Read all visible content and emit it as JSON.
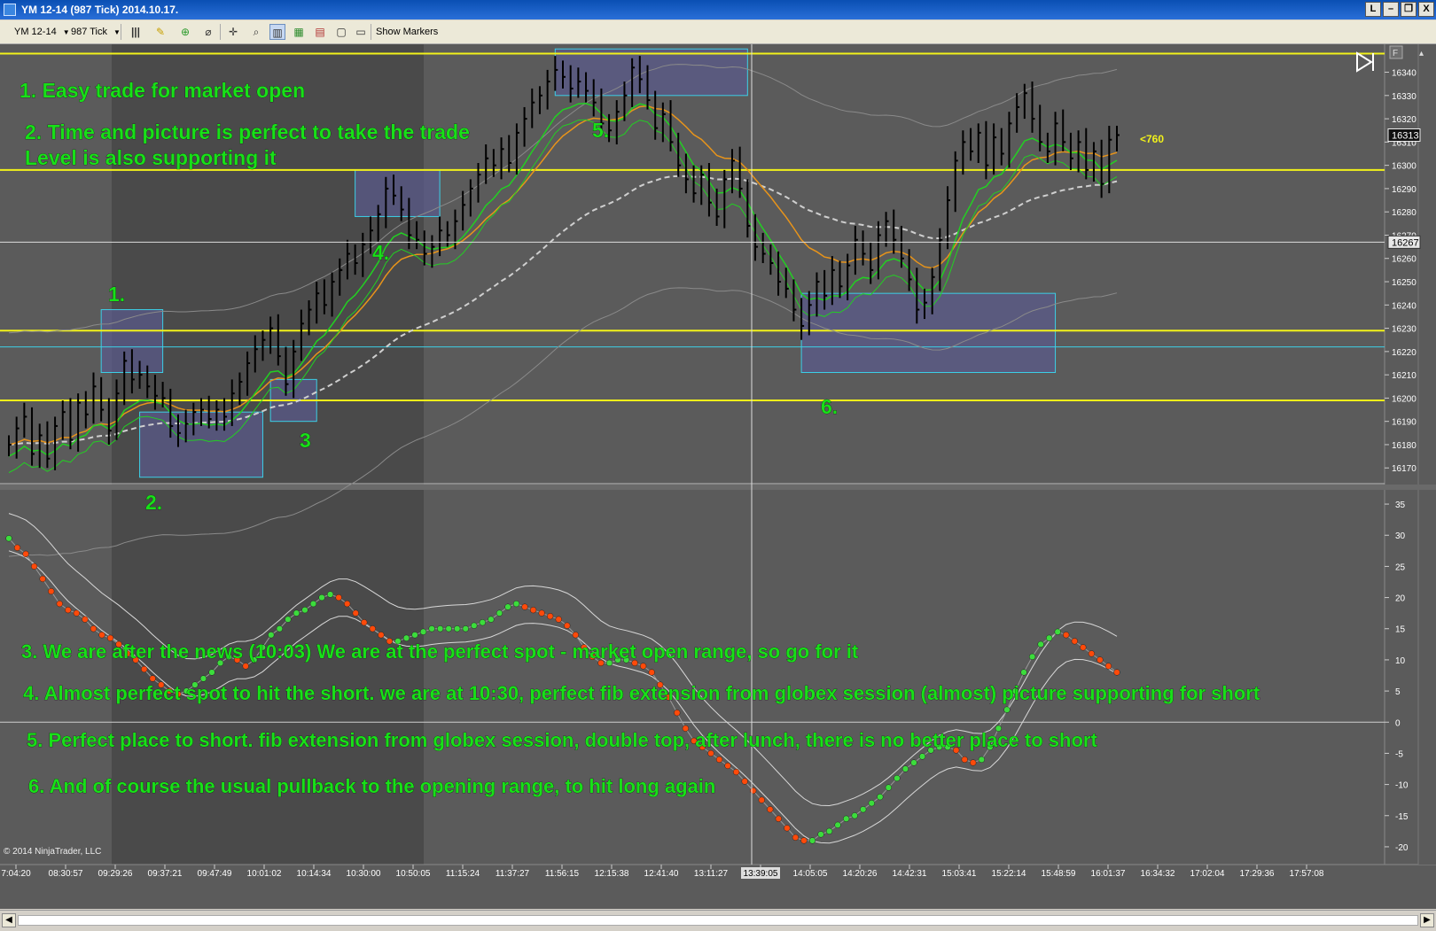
{
  "window": {
    "title": "YM 12-14 (987 Tick)  2014.10.17.",
    "buttons": [
      "L",
      "–",
      "❐",
      "X"
    ]
  },
  "toolbar": {
    "instrument": "YM 12-14",
    "period": "987 Tick",
    "show_markers": "Show Markers"
  },
  "chart": {
    "copyright": "© 2014 NinjaTrader, LLC",
    "price_label_current": "16313",
    "price_label_crosshair": "16267",
    "tick_counter": "<760",
    "crosshair_time": "13:39:05",
    "annotations_top": [
      "1. Easy trade for market open",
      "2. Time and picture is perfect to take the trade",
      "Level is also supporting it"
    ],
    "annotations_bottom": [
      "3. We are after the news (10:03) We are at the perfect spot - market open range, so go for it",
      "4. Almost perfect spot to hit the short. we are at 10:30, perfect fib extension from globex session (almost) picture supporting for short",
      "5. Perfect place to short. fib extension from globex session, double top, after lunch, there is no better place to short",
      "6. And of course the usual pullback to the opening range, to hit long again"
    ],
    "box_labels": [
      "1.",
      "2.",
      "3",
      "4.",
      "5.",
      "6."
    ],
    "colors": {
      "background": "#5b5b5b",
      "session_shade": "#4a4a4a",
      "level_line": "#f2f21a",
      "annotation_text": "#18e018",
      "box_fill": "#5a5a8a",
      "box_stroke": "#3ccfe6",
      "osc_red": "#ff4a0a",
      "osc_green": "#3cdc3c",
      "ma_green": "#22d022",
      "ma_orange": "#e8941a"
    }
  },
  "chart_data": {
    "type": "line",
    "panels": [
      {
        "name": "price",
        "y_ticks": [
          16340,
          16330,
          16320,
          16310,
          16300,
          16290,
          16280,
          16270,
          16260,
          16250,
          16240,
          16230,
          16220,
          16210,
          16200,
          16190,
          16180,
          16170
        ],
        "ylim": [
          16164,
          16352
        ],
        "level_lines": [
          16348,
          16298,
          16229,
          16199
        ],
        "cyan_line": 16222,
        "crosshair_price": 16267,
        "close": [
          16180,
          16187,
          16192,
          16176,
          16184,
          16174,
          16188,
          16194,
          16182,
          16198,
          16193,
          16205,
          16195,
          16186,
          16202,
          16216,
          16208,
          16210,
          16205,
          16201,
          16200,
          16188,
          16185,
          16189,
          16194,
          16195,
          16191,
          16195,
          16192,
          16202,
          16207,
          16215,
          16221,
          16225,
          16230,
          16218,
          16206,
          16220,
          16232,
          16238,
          16245,
          16240,
          16250,
          16255,
          16262,
          16258,
          16266,
          16272,
          16279,
          16290,
          16287,
          16281,
          16270,
          16268,
          16262,
          16265,
          16272,
          16270,
          16276,
          16283,
          16290,
          16296,
          16303,
          16300,
          16307,
          16301,
          16314,
          16320,
          16327,
          16330,
          16336,
          16341,
          16338,
          16333,
          16336,
          16332,
          16327,
          16318,
          16315,
          16323,
          16330,
          16342,
          16337,
          16328,
          16316,
          16322,
          16310,
          16300,
          16294,
          16288,
          16296,
          16284,
          16278,
          16294,
          16302,
          16290,
          16274,
          16265,
          16262,
          16258,
          16250,
          16247,
          16238,
          16231,
          16240,
          16250,
          16244,
          16255,
          16248,
          16257,
          16268,
          16262,
          16255,
          16270,
          16276,
          16268,
          16260,
          16251,
          16238,
          16241,
          16252,
          16268,
          16285,
          16302,
          16310,
          16306,
          16314,
          16300,
          16312,
          16305,
          16318,
          16325,
          16331,
          16320,
          16310,
          16306,
          16318,
          16310,
          16303,
          16310,
          16298,
          16306,
          16292,
          16311,
          16313
        ]
      },
      {
        "name": "oscillator",
        "y_ticks": [
          35,
          30,
          25,
          20,
          15,
          10,
          5,
          0,
          -5,
          -10,
          -15,
          -20
        ],
        "ylim": [
          -22,
          37
        ],
        "zero_line": 0,
        "values": [
          29.5,
          28,
          27,
          25,
          23,
          21,
          19,
          18,
          17.5,
          16.5,
          15,
          14,
          13.5,
          12.5,
          11,
          10,
          8.5,
          7,
          6,
          5,
          4.5,
          5,
          6,
          7,
          8,
          9.5,
          10.5,
          10,
          9,
          10,
          12,
          14,
          15,
          16.5,
          17.5,
          18,
          19,
          20,
          20.5,
          20,
          19,
          17.5,
          16,
          15,
          14,
          13,
          13,
          13.5,
          14,
          14.5,
          15,
          15,
          15,
          15,
          15,
          15.5,
          16,
          16.5,
          17.5,
          18.5,
          19,
          18.5,
          18,
          17.5,
          17,
          16.5,
          15.5,
          14,
          12,
          10.5,
          9.5,
          9.5,
          10,
          10,
          9.5,
          9,
          8,
          6,
          4,
          1.5,
          -1,
          -3,
          -4,
          -5,
          -6,
          -7,
          -8,
          -9.5,
          -11,
          -12.5,
          -14,
          -15.5,
          -17,
          -18.5,
          -19,
          -19,
          -18,
          -17.5,
          -16.5,
          -15.5,
          -15,
          -14,
          -13,
          -12,
          -10.5,
          -9,
          -7.5,
          -6.5,
          -5.5,
          -4.5,
          -4,
          -4,
          -4.5,
          -6,
          -6.5,
          -6,
          -4,
          -1,
          2,
          5,
          8,
          10.5,
          12.5,
          13.5,
          14.5,
          14,
          13,
          12,
          11,
          10,
          9,
          8
        ]
      }
    ],
    "x_tick_labels": [
      "7:04:20",
      "08:30:57",
      "09:29:26",
      "09:37:21",
      "09:47:49",
      "10:01:02",
      "10:14:34",
      "10:30:00",
      "10:50:05",
      "11:15:24",
      "11:37:27",
      "11:56:15",
      "12:15:38",
      "12:41:40",
      "13:11:27",
      "13:39:05",
      "14:05:05",
      "14:20:26",
      "14:42:31",
      "15:03:41",
      "15:22:14",
      "15:48:59",
      "16:01:37",
      "16:34:32",
      "17:02:04",
      "17:29:36",
      "17:57:08"
    ]
  }
}
